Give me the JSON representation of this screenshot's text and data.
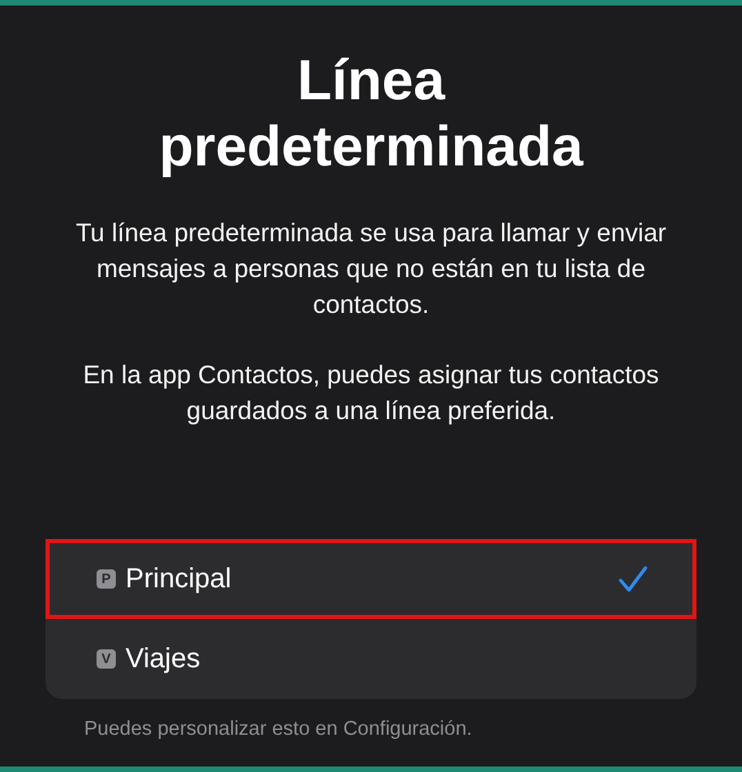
{
  "title": "Línea predeterminada",
  "paragraphs": [
    "Tu línea predeterminada se usa para llamar y enviar mensajes a personas que no están en tu lista de contactos.",
    "En la app Contactos, puedes asignar tus contactos guardados a una línea preferida."
  ],
  "lines": [
    {
      "badge": "P",
      "label": "Principal",
      "selected": true,
      "highlighted": true
    },
    {
      "badge": "V",
      "label": "Viajes",
      "selected": false,
      "highlighted": false
    }
  ],
  "footer": "Puedes personalizar esto en Configuración."
}
